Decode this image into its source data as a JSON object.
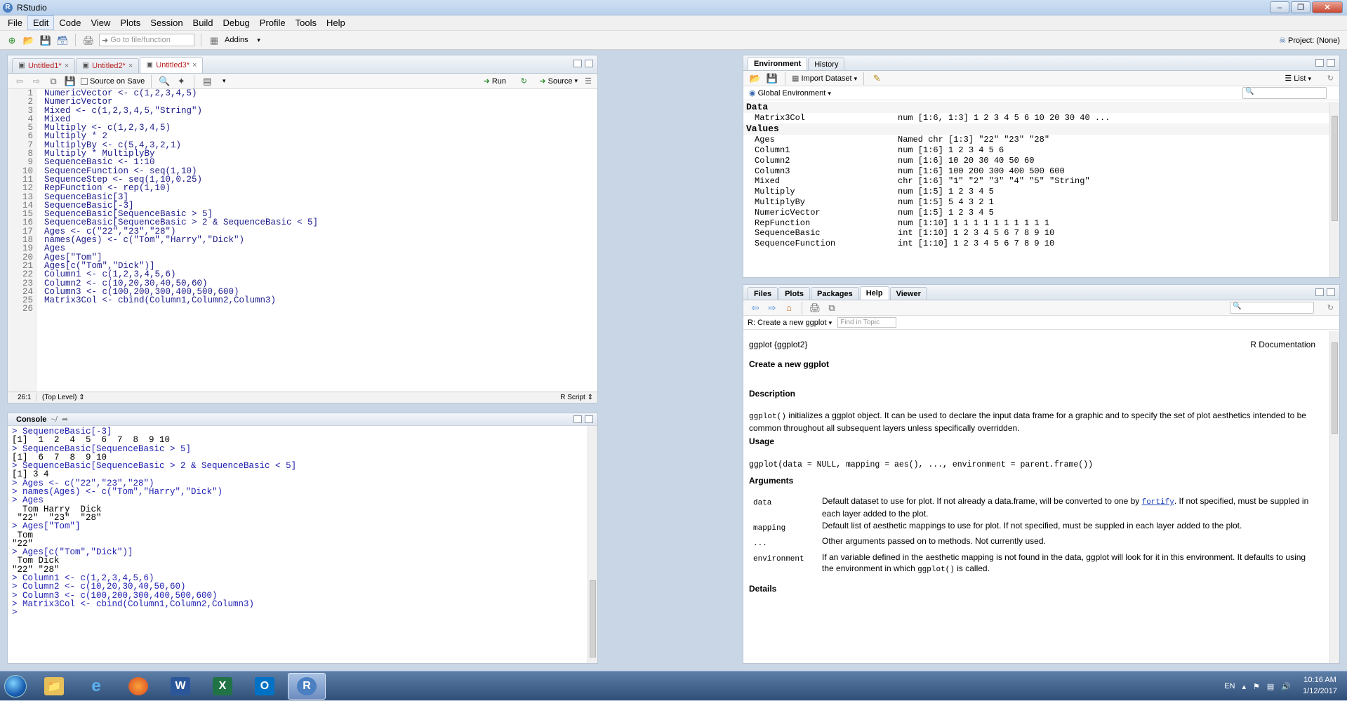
{
  "window": {
    "title": "RStudio"
  },
  "menu": [
    "File",
    "Edit",
    "Code",
    "View",
    "Plots",
    "Session",
    "Build",
    "Debug",
    "Profile",
    "Tools",
    "Help"
  ],
  "toolbar": {
    "goto_placeholder": "Go to file/function",
    "addins": "Addins",
    "project": "Project: (None)"
  },
  "editor": {
    "tabs": [
      {
        "label": "Untitled1*"
      },
      {
        "label": "Untitled2*"
      },
      {
        "label": "Untitled3*"
      }
    ],
    "source_on_save": "Source on Save",
    "run": "Run",
    "source": "Source",
    "lines": [
      "NumericVector <- c(1,2,3,4,5)",
      "NumericVector",
      "Mixed <- c(1,2,3,4,5,\"String\")",
      "Mixed",
      "Multiply <- c(1,2,3,4,5)",
      "Multiply * 2",
      "MultiplyBy <- c(5,4,3,2,1)",
      "Multiply * MultiplyBy",
      "SequenceBasic <- 1:10",
      "SequenceFunction <- seq(1,10)",
      "SequenceStep <- seq(1,10,0.25)",
      "RepFunction <- rep(1,10)",
      "SequenceBasic[3]",
      "SequenceBasic[-3]",
      "SequenceBasic[SequenceBasic > 5]",
      "SequenceBasic[SequenceBasic > 2 & SequenceBasic < 5]",
      "Ages <- c(\"22\",\"23\",\"28\")",
      "names(Ages) <- c(\"Tom\",\"Harry\",\"Dick\")",
      "Ages",
      "Ages[\"Tom\"]",
      "Ages[c(\"Tom\",\"Dick\")]",
      "Column1 <- c(1,2,3,4,5,6)",
      "Column2 <- c(10,20,30,40,50,60)",
      "Column3 <- c(100,200,300,400,500,600)",
      "Matrix3Col <- cbind(Column1,Column2,Column3)",
      ""
    ],
    "line_numbers": [
      "1",
      "2",
      "3",
      "4",
      "5",
      "6",
      "7",
      "8",
      "9",
      "10",
      "11",
      "12",
      "13",
      "14",
      "15",
      "16",
      "17",
      "18",
      "19",
      "20",
      "21",
      "22",
      "23",
      "24",
      "25",
      "26"
    ],
    "status_pos": "26:1",
    "status_scope": "(Top Level)",
    "status_type": "R Script"
  },
  "console": {
    "title": "Console",
    "path": "~/",
    "lines": [
      {
        "t": "> SequenceBasic[-3]",
        "c": true
      },
      {
        "t": "[1]  1  2  4  5  6  7  8  9 10",
        "c": false
      },
      {
        "t": "> SequenceBasic[SequenceBasic > 5]",
        "c": true
      },
      {
        "t": "[1]  6  7  8  9 10",
        "c": false
      },
      {
        "t": "> SequenceBasic[SequenceBasic > 2 & SequenceBasic < 5]",
        "c": true
      },
      {
        "t": "[1] 3 4",
        "c": false
      },
      {
        "t": "> Ages <- c(\"22\",\"23\",\"28\")",
        "c": true
      },
      {
        "t": "> names(Ages) <- c(\"Tom\",\"Harry\",\"Dick\")",
        "c": true
      },
      {
        "t": "> Ages",
        "c": true
      },
      {
        "t": "  Tom Harry  Dick ",
        "c": false
      },
      {
        "t": " \"22\"  \"23\"  \"28\" ",
        "c": false
      },
      {
        "t": "> Ages[\"Tom\"]",
        "c": true
      },
      {
        "t": " Tom ",
        "c": false
      },
      {
        "t": "\"22\" ",
        "c": false
      },
      {
        "t": "> Ages[c(\"Tom\",\"Dick\")]",
        "c": true
      },
      {
        "t": " Tom Dick ",
        "c": false
      },
      {
        "t": "\"22\" \"28\" ",
        "c": false
      },
      {
        "t": "> Column1 <- c(1,2,3,4,5,6)",
        "c": true
      },
      {
        "t": "> Column2 <- c(10,20,30,40,50,60)",
        "c": true
      },
      {
        "t": "> Column3 <- c(100,200,300,400,500,600)",
        "c": true
      },
      {
        "t": "> Matrix3Col <- cbind(Column1,Column2,Column3)",
        "c": true
      },
      {
        "t": "> ",
        "c": true
      }
    ]
  },
  "environment": {
    "tabs": [
      "Environment",
      "History"
    ],
    "import_dataset": "Import Dataset",
    "list_label": "List",
    "scope": "Global Environment",
    "data_header": "Data",
    "data": [
      {
        "name": "Matrix3Col",
        "value": "num [1:6, 1:3] 1 2 3 4 5 6 10 20 30 40 ..."
      }
    ],
    "values_header": "Values",
    "values": [
      {
        "name": "Ages",
        "value": "Named chr [1:3] \"22\" \"23\" \"28\""
      },
      {
        "name": "Column1",
        "value": "num [1:6] 1 2 3 4 5 6"
      },
      {
        "name": "Column2",
        "value": "num [1:6] 10 20 30 40 50 60"
      },
      {
        "name": "Column3",
        "value": "num [1:6] 100 200 300 400 500 600"
      },
      {
        "name": "Mixed",
        "value": "chr [1:6] \"1\" \"2\" \"3\" \"4\" \"5\" \"String\""
      },
      {
        "name": "Multiply",
        "value": "num [1:5] 1 2 3 4 5"
      },
      {
        "name": "MultiplyBy",
        "value": "num [1:5] 5 4 3 2 1"
      },
      {
        "name": "NumericVector",
        "value": "num [1:5] 1 2 3 4 5"
      },
      {
        "name": "RepFunction",
        "value": "num [1:10] 1 1 1 1 1 1 1 1 1 1"
      },
      {
        "name": "SequenceBasic",
        "value": "int [1:10] 1 2 3 4 5 6 7 8 9 10"
      },
      {
        "name": "SequenceFunction",
        "value": "int [1:10] 1 2 3 4 5 6 7 8 9 10"
      }
    ]
  },
  "help": {
    "tabs": [
      "Files",
      "Plots",
      "Packages",
      "Help",
      "Viewer"
    ],
    "topic": "R: Create a new ggplot",
    "find_placeholder": "Find in Topic",
    "pkg": "ggplot {ggplot2}",
    "rdoc": "R Documentation",
    "title": "Create a new ggplot",
    "description_h": "Description",
    "description_code": "ggplot()",
    "description_text": " initializes a ggplot object. It can be used to declare the input data frame for a graphic and to specify the set of plot aesthetics intended to be common throughout all subsequent layers unless specifically overridden.",
    "usage_h": "Usage",
    "usage": "ggplot(data = NULL, mapping = aes(), ..., environment = parent.frame())",
    "arguments_h": "Arguments",
    "args": {
      "data_name": "data",
      "data_text1": "Default dataset to use for plot. If not already a data.frame, will be converted to one by ",
      "data_link": "fortify",
      "data_text2": ". If not specified, must be suppled in each layer added to the plot.",
      "mapping_name": "mapping",
      "mapping_text": "Default list of aesthetic mappings to use for plot. If not specified, must be suppled in each layer added to the plot.",
      "dots_name": "...",
      "dots_text": "Other arguments passed on to methods. Not currently used.",
      "env_name": "environment",
      "env_text1": "If an variable defined in the aesthetic mapping is not found in the data, ggplot will look for it in this environment. It defaults to using the environment in which ",
      "env_code": "ggplot()",
      "env_text2": " is called."
    },
    "details_h": "Details"
  },
  "taskbar": {
    "lang": "EN",
    "time": "10:16 AM",
    "date": "1/12/2017",
    "rstudio_letter": "R",
    "word_letter": "W",
    "excel_letter": "X",
    "outlook_letter": "O"
  }
}
